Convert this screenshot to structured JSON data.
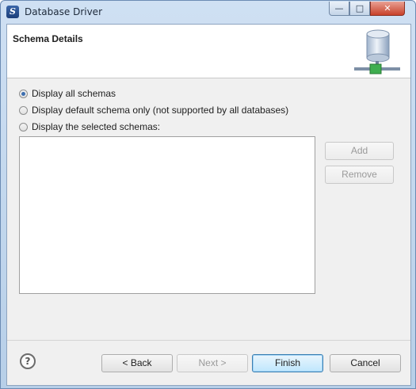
{
  "window": {
    "title": "Database Driver",
    "controls": {
      "minimize": "—",
      "maximize": "□",
      "close": "✕"
    }
  },
  "header": {
    "title": "Schema Details"
  },
  "options": [
    {
      "label": "Display all schemas",
      "checked": true
    },
    {
      "label": "Display default schema only (not supported by all databases)",
      "checked": false
    },
    {
      "label": "Display the selected schemas:",
      "checked": false
    }
  ],
  "schema_list": {
    "items": []
  },
  "side_buttons": {
    "add": "Add",
    "remove": "Remove"
  },
  "footer": {
    "help": "?",
    "back": "< Back",
    "next": "Next >",
    "finish": "Finish",
    "cancel": "Cancel"
  }
}
